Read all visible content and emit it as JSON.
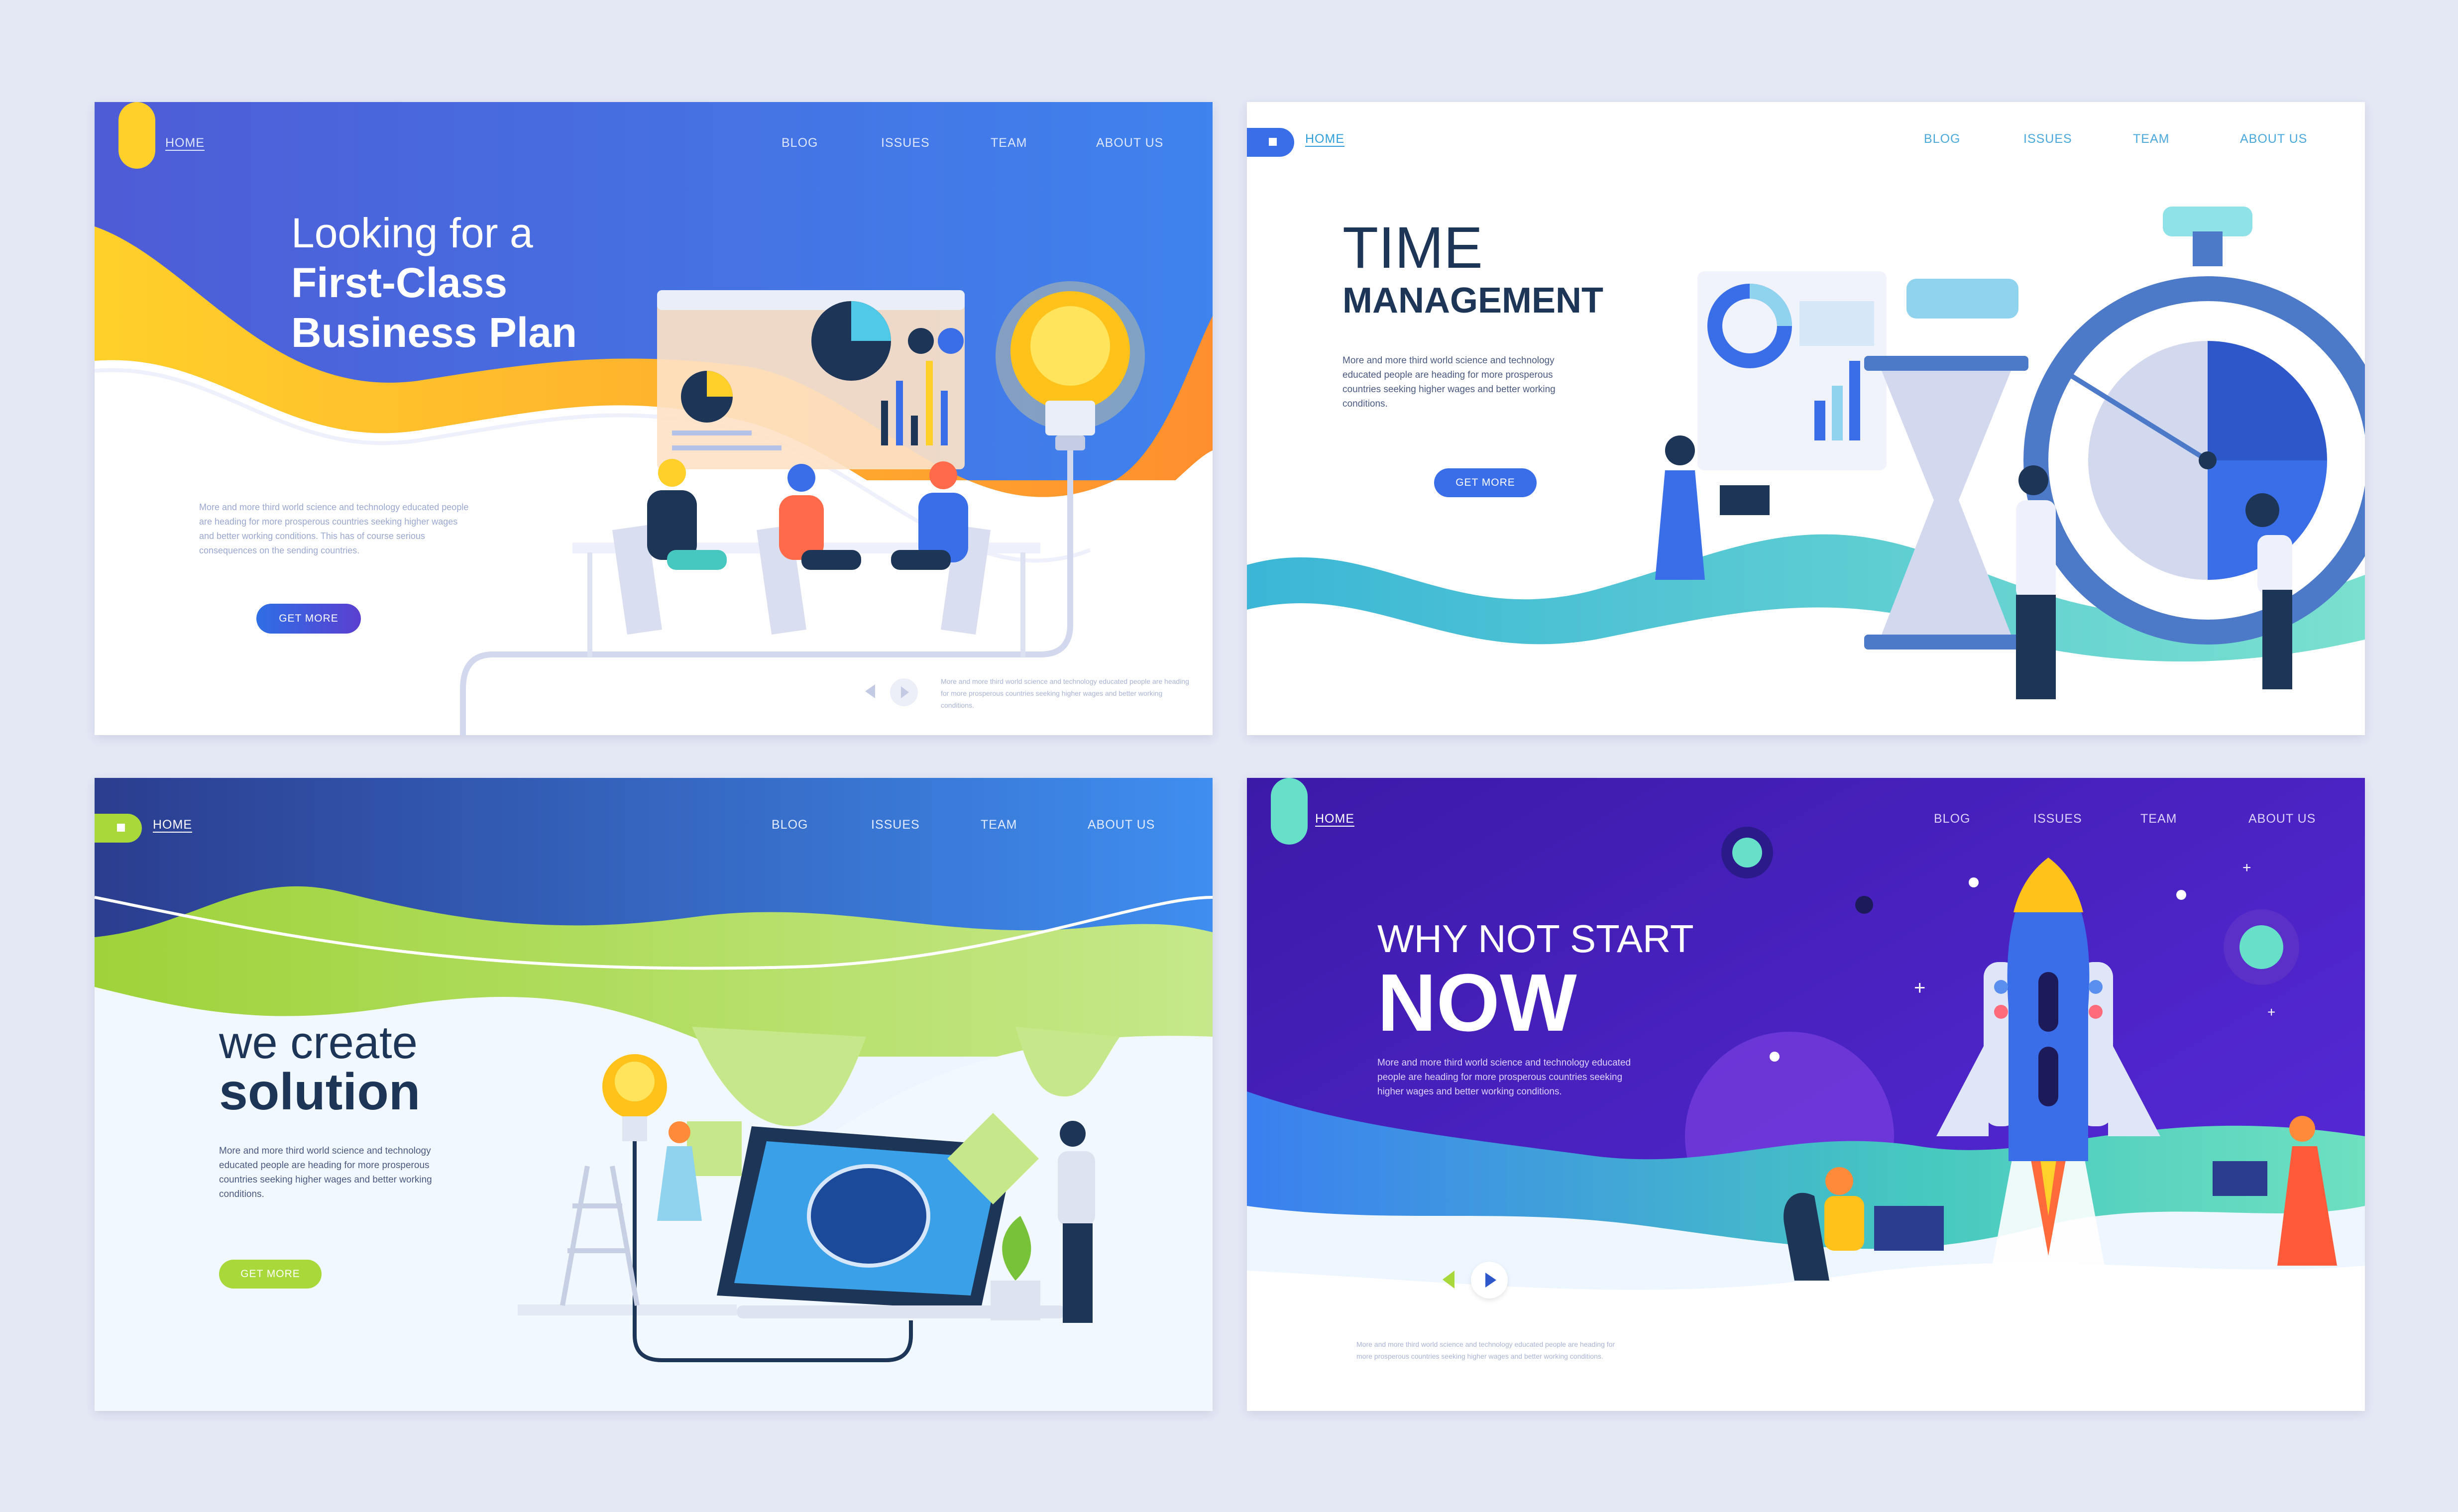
{
  "colors": {
    "page_bg": "#e4e8f5",
    "dark_text": "#1d3557",
    "blue": "#3a6ee8",
    "purple": "#4b1fbf",
    "green": "#a8d83a",
    "teal": "#46c8c0",
    "yellow": "#ffd12b",
    "orange": "#ff9a2e"
  },
  "nav": {
    "home": "HOME",
    "blog": "BLOG",
    "issues": "ISSUES",
    "team": "TEAM",
    "about": "ABOUT US"
  },
  "card1": {
    "title_line1": "Looking for a",
    "title_line2": "First-Class",
    "title_line3": "Business Plan",
    "paragraph": "More and more third world science and technology educated people are heading for more prosperous countries seeking higher wages and better working conditions. This has of course serious consequences on the sending countries.",
    "button": "GET MORE",
    "caption": "More and more third world science and technology educated people are heading for more prosperous countries seeking higher wages and better working conditions."
  },
  "card2": {
    "title_line1": "TIME",
    "title_line2": "MANAGEMENT",
    "paragraph": "More and more third world science and technology educated people are heading for more prosperous countries seeking higher wages and better working conditions.",
    "button": "GET MORE"
  },
  "card3": {
    "title_line1": "we create",
    "title_line2": "solution",
    "paragraph": "More and more third world science and technology educated people are heading for more prosperous countries seeking higher wages and better working conditions.",
    "button": "GET MORE"
  },
  "card4": {
    "title_line1": "WHY NOT START",
    "title_line2": "NOW",
    "paragraph": "More and more third world science and technology educated people are heading for more prosperous countries seeking higher wages and better working conditions.",
    "caption": "More and more third world science and technology educated people are heading for more prosperous countries seeking higher wages and better working conditions."
  },
  "icons": {
    "home_tab": "home-icon",
    "prev": "chevron-left-icon",
    "next": "chevron-right-icon",
    "play": "play-icon"
  }
}
